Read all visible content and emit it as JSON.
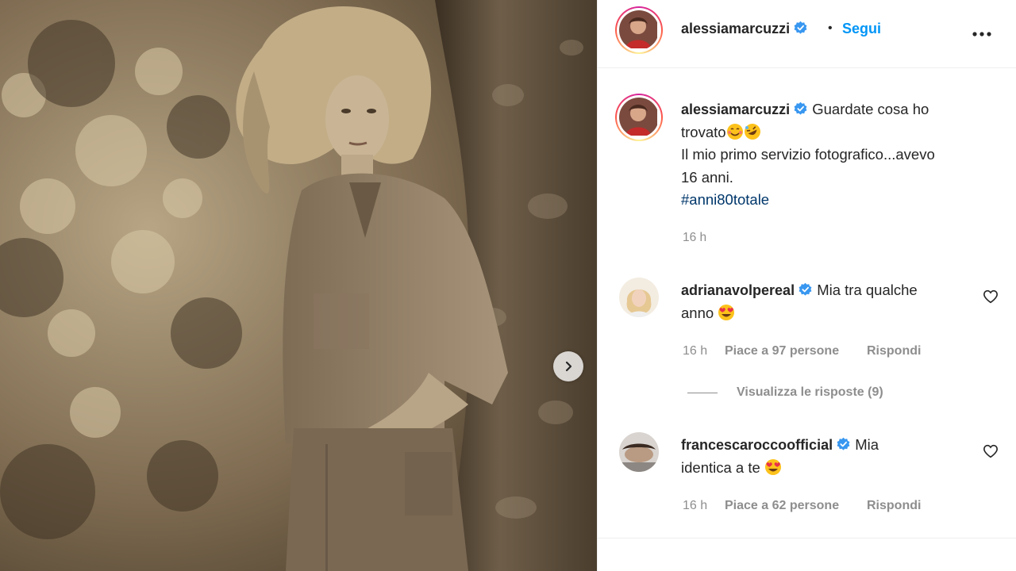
{
  "post": {
    "image_alt": "vintage sepia photo of a young woman leaning on a tree",
    "next_icon": "chevron-right-icon"
  },
  "header": {
    "username": "alessiamarcuzzi",
    "separator": "•",
    "follow_label": "Segui",
    "more_icon": "more-horizontal-icon"
  },
  "caption": {
    "username": "alessiamarcuzzi",
    "line1": "Guardate cosa ho",
    "line2": "trovato",
    "line3": "Il mio primo servizio fotografico...avevo",
    "line4": "16 anni.",
    "hashtag": "#anni80totale",
    "time": "16 h"
  },
  "comments": [
    {
      "username": "adrianavolpereal",
      "text1": "Mia tra qualche",
      "text2": "anno",
      "time": "16 h",
      "likes": "Piace a 97 persone",
      "reply": "Rispondi",
      "view_replies": "Visualizza le risposte (9)"
    },
    {
      "username": "francescaroccoofficial",
      "text1": "Mia",
      "text2": "identica a te",
      "time": "16 h",
      "likes": "Piace a 62 persone",
      "reply": "Rispondi"
    }
  ],
  "colors": {
    "accent": "#0095f6",
    "verified": "#3897f0",
    "muted": "#8e8e8e",
    "hashtag": "#00376b"
  }
}
